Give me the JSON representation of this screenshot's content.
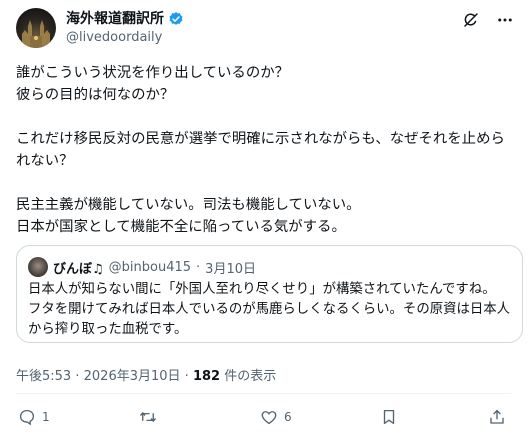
{
  "author": {
    "name": "海外報道翻訳所",
    "handle": "@livedoordaily",
    "verified_color": "#1d9bf0"
  },
  "top_actions": {
    "grok_icon": "grok-icon",
    "more_icon": "more-icon"
  },
  "tweet": {
    "text": "誰がこういう状況を作り出しているのか？\n彼らの目的は何なのか？\n\nこれだけ移民反対の民意が選挙で明確に示されながらも、なぜそれを止められない？\n\n民主主義が機能していない。司法も機能していない。\n日本が国家として機能不全に陥っている気がする。"
  },
  "quote": {
    "name": "びんぼ♫",
    "handle": "@binbou415",
    "separator": "·",
    "date": "3月10日",
    "text": "日本人が知らない間に「外国人至れり尽くせり」が構築されていたんですね。\nフタを開けてみれば日本人でいるのが馬鹿らしくなるくらい。その原資は日本人から搾り取った血税です。"
  },
  "meta": {
    "time": "午後5:53",
    "separator": "·",
    "date": "2026年3月10日",
    "separator2": "·",
    "views": "182",
    "views_label": "件の表示"
  },
  "actions": {
    "reply_count": "1",
    "retweet_count": "",
    "like_count": "6"
  },
  "colors": {
    "text": "#0f1419",
    "secondary": "#536471",
    "border": "#cfd9de"
  }
}
